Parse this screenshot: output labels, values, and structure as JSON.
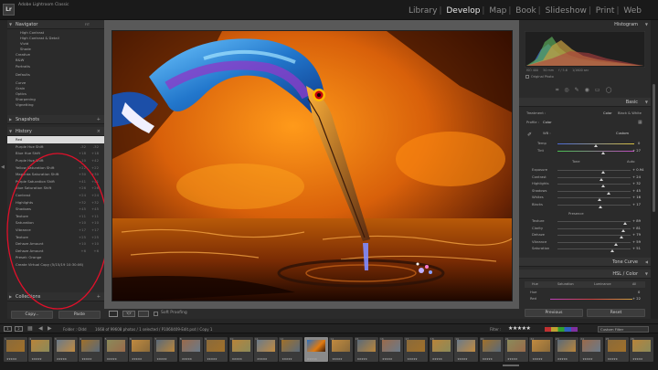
{
  "app": {
    "logo": "Lr",
    "identity_plate": "Adobe Lightroom Classic"
  },
  "modules": [
    {
      "label": "Library",
      "active": false
    },
    {
      "label": "Develop",
      "active": true
    },
    {
      "label": "Map",
      "active": false
    },
    {
      "label": "Book",
      "active": false
    },
    {
      "label": "Slideshow",
      "active": false
    },
    {
      "label": "Print",
      "active": false
    },
    {
      "label": "Web",
      "active": false
    }
  ],
  "left_panel": {
    "navigator": {
      "title": "Navigator",
      "fit_label": "FIT",
      "zoom_opts": [
        "100%",
        "200%"
      ]
    },
    "presets": [
      {
        "label": "High Contrast",
        "group": false
      },
      {
        "label": "High Contrast & Detail",
        "group": false
      },
      {
        "label": "Vivid",
        "group": false
      },
      {
        "label": "Shade",
        "group": false
      },
      {
        "label": "Creative",
        "group": true
      },
      {
        "label": "B&W",
        "group": true
      },
      {
        "label": "Portraits",
        "group": true
      },
      {
        "label": "Defaults",
        "group": true
      },
      {
        "label": "Curve",
        "group": true
      },
      {
        "label": "Grain",
        "group": true
      },
      {
        "label": "Optics",
        "group": true
      },
      {
        "label": "Sharpening",
        "group": true
      },
      {
        "label": "Vignetting",
        "group": true
      }
    ],
    "snapshots_title": "Snapshots",
    "history_title": "History",
    "history": [
      {
        "label": "Red",
        "v1": "",
        "v2": "",
        "selected": true
      },
      {
        "label": "Purple Hue Shift",
        "v1": "-32",
        "v2": "-32"
      },
      {
        "label": "Blue Hue Shift",
        "v1": "+18",
        "v2": "+18"
      },
      {
        "label": "Purple Hue Shift",
        "v1": "-10",
        "v2": "+42"
      },
      {
        "label": "Yellow Saturation Shift",
        "v1": "+22",
        "v2": "+22"
      },
      {
        "label": "Magenta Saturation Shift",
        "v1": "+30",
        "v2": "+30"
      },
      {
        "label": "Purple Saturation Shift",
        "v1": "+41",
        "v2": "+41"
      },
      {
        "label": "Blue Saturation Shift",
        "v1": "+26",
        "v2": "+26"
      },
      {
        "label": "Contrast",
        "v1": "+24",
        "v2": "+24"
      },
      {
        "label": "Highlights",
        "v1": "+32",
        "v2": "+32"
      },
      {
        "label": "Shadows",
        "v1": "+45",
        "v2": "+45"
      },
      {
        "label": "Texture",
        "v1": "+11",
        "v2": "+11"
      },
      {
        "label": "Saturation",
        "v1": "+10",
        "v2": "+10"
      },
      {
        "label": "Vibrance",
        "v1": "+17",
        "v2": "+17"
      },
      {
        "label": "Texture",
        "v1": "+25",
        "v2": "+25"
      },
      {
        "label": "Dehaze Amount",
        "v1": "+10",
        "v2": "+10"
      },
      {
        "label": "Dehaze Amount",
        "v1": "+6",
        "v2": "+6"
      },
      {
        "label": "Preset: Orange",
        "v1": "",
        "v2": ""
      },
      {
        "label": "Create Virtual Copy (5/15/19 10:30:06)",
        "v1": "",
        "v2": ""
      }
    ],
    "collections_title": "Collections",
    "copy_label": "Copy...",
    "paste_label": "Paste"
  },
  "toolbar": {
    "soft_proofing": "Soft Proofing"
  },
  "right_panel": {
    "histogram_title": "Histogram",
    "histo_readout": [
      "ISO 400",
      "50 mm",
      "f / 5.6",
      "1/1600 sec"
    ],
    "original_photo": "Original Photo",
    "basic_title": "Basic",
    "treatment_label": "Treatment :",
    "treatment_color": "Color",
    "treatment_bw": "Black & White",
    "profile_label": "Profile :",
    "profile_value": "Color",
    "wb_label": "WB :",
    "wb_value": "Custom",
    "temp_label": "Temp",
    "temp_value": "0",
    "tint_label": "Tint",
    "tint_value": "+ 27",
    "tone_label": "Tone",
    "auto_label": "Auto",
    "tone_rows": [
      {
        "label": "Exposure",
        "value": "+ 0.94",
        "pos": 0.62
      },
      {
        "label": "Contrast",
        "value": "+ 24",
        "pos": 0.6
      },
      {
        "label": "Highlights",
        "value": "+ 32",
        "pos": 0.62
      },
      {
        "label": "Shadows",
        "value": "+ 45",
        "pos": 0.7
      },
      {
        "label": "Whites",
        "value": "+ 16",
        "pos": 0.58
      },
      {
        "label": "Blacks",
        "value": "+ 17",
        "pos": 0.59
      }
    ],
    "presence_label": "Presence",
    "presence_rows": [
      {
        "label": "Texture",
        "value": "+ 89",
        "pos": 0.92
      },
      {
        "label": "Clarity",
        "value": "+ 81",
        "pos": 0.9
      },
      {
        "label": "Dehaze",
        "value": "+ 79",
        "pos": 0.88
      },
      {
        "label": "Vibrance",
        "value": "+ 59",
        "pos": 0.8
      },
      {
        "label": "Saturation",
        "value": "+ 51",
        "pos": 0.75
      }
    ],
    "tone_curve_title": "Tone Curve",
    "hsl_title": "HSL / Color",
    "hsl_tabs": [
      "Hue",
      "Saturation",
      "Luminance",
      "All"
    ],
    "hsl_hue_label": "Hue",
    "red_label": "Red",
    "red_value": "0",
    "red2_value": "+ 22",
    "previous_label": "Previous",
    "reset_label": "Reset"
  },
  "filmstrip": {
    "pages": [
      "1",
      "2"
    ],
    "path": "Folder : Oldd",
    "count": "1668 of 99608 photos / 1 selected / P1060409-Edit.psd / Copy 1",
    "filter_label": "Filter :",
    "custom_filter": "Custom Filter",
    "thumbs": [
      {
        "n": "1"
      },
      {
        "n": "2"
      },
      {
        "n": "3"
      },
      {
        "n": "4"
      },
      {
        "n": "5"
      },
      {
        "n": "6"
      },
      {
        "n": "7"
      },
      {
        "n": "8"
      },
      {
        "n": "9"
      },
      {
        "n": "10"
      },
      {
        "n": "11"
      },
      {
        "n": "12"
      },
      {
        "n": "13",
        "sel": true
      },
      {
        "n": "14"
      },
      {
        "n": "15"
      },
      {
        "n": "16"
      },
      {
        "n": "17"
      },
      {
        "n": "18"
      },
      {
        "n": "19"
      },
      {
        "n": "20"
      },
      {
        "n": "21"
      },
      {
        "n": "22"
      },
      {
        "n": "23"
      },
      {
        "n": "24"
      },
      {
        "n": "25"
      },
      {
        "n": "26"
      }
    ]
  }
}
